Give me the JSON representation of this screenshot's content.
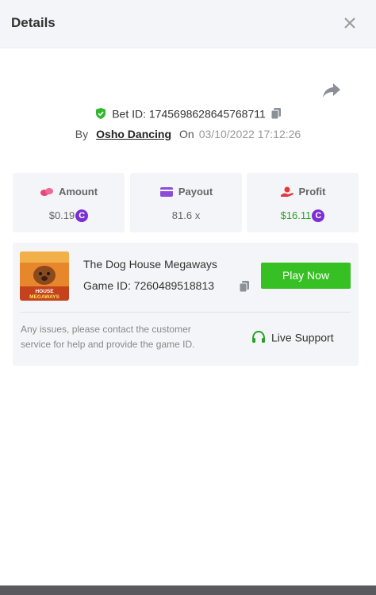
{
  "header": {
    "title": "Details",
    "close_icon": "close-icon"
  },
  "share_icon": "share-arrow-icon",
  "bet": {
    "id_label": "Bet ID:",
    "id_value": "1745698628645768711",
    "by_label": "By",
    "username": "Osho Dancing",
    "on_label": "On",
    "timestamp": "03/10/2022 17:12:26"
  },
  "stats": {
    "amount": {
      "label": "Amount",
      "value": "$0.19",
      "icon": "coins-icon"
    },
    "payout": {
      "label": "Payout",
      "value": "81.6 x",
      "icon": "wallet-icon"
    },
    "profit": {
      "label": "Profit",
      "value": "$16.11",
      "icon": "hand-coin-icon"
    }
  },
  "game": {
    "name": "The Dog House Megaways",
    "id_label": "Game ID:",
    "id_value": "7260489518813",
    "play_label": "Play Now",
    "thumb_text": "THE DOG HOUSE MEGAWAYS"
  },
  "support": {
    "notice": "Any issues, please contact the customer service for help and provide the game ID.",
    "label": "Live Support"
  },
  "coin_symbol": "C",
  "colors": {
    "accent_green": "#37c024",
    "profit_green": "#2aa12a",
    "coin_purple": "#7b2fd3",
    "panel_bg": "#f4f5f8"
  }
}
